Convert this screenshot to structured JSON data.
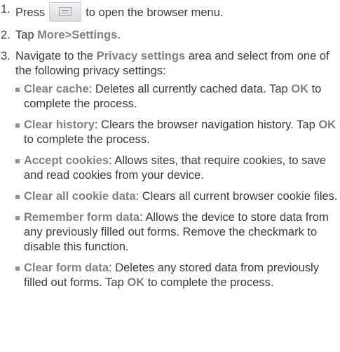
{
  "steps": [
    {
      "num": "1.",
      "before": "Press",
      "key_icon": "menu-key-icon",
      "after": "to open the browser menu."
    },
    {
      "num": "2.",
      "before": "Tap ",
      "bold1": "More",
      "arrow": ">",
      "bold2": "Settings",
      "after": "."
    },
    {
      "num": "3.",
      "before": "Navigate to the ",
      "bold": "Privacy settings",
      "after": " area and select from one of the following privacy settings:"
    }
  ],
  "privacy_items": [
    {
      "title": "Clear cache",
      "desc": ": Deletes all currently cached data. Tap ",
      "ok": "OK",
      "tail": " to complete the process."
    },
    {
      "title": "Clear history",
      "desc": ": Clears the browser navigation history. Tap ",
      "ok": "OK",
      "tail": " to complete the process."
    },
    {
      "title": "Accept cookies",
      "desc": ": Allows sites, that require cookies, to save and read cookies from your device."
    },
    {
      "title": "Clear all cookie data",
      "desc": ": Clears all current browser cookie files."
    },
    {
      "title": "Remember form data",
      "desc": ": Allows the device to store data from any previously filled out forms. Remove the checkmark to disable this function."
    },
    {
      "title": "Clear form data",
      "desc": ": Deletes any stored data from previously filled out forms. Tap ",
      "ok": "OK",
      "tail": " to complete the process."
    }
  ],
  "colors": {
    "text": "#3a3a3a",
    "emphasis": "#7e8187"
  }
}
